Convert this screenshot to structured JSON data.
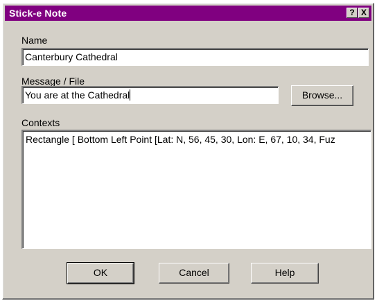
{
  "window": {
    "title": "Stick-e Note",
    "help_button": "?",
    "close_button": "X"
  },
  "name": {
    "label": "Name",
    "value": "Canterbury Cathedral"
  },
  "message": {
    "label": "Message / File",
    "value": "You are at the Cathedral",
    "browse_label": "Browse..."
  },
  "contexts": {
    "label": "Contexts",
    "items": [
      "Rectangle [ Bottom Left Point [Lat: N, 56, 45, 30, Lon: E, 67, 10, 34, Fuz"
    ]
  },
  "buttons": {
    "ok": "OK",
    "cancel": "Cancel",
    "help": "Help"
  }
}
